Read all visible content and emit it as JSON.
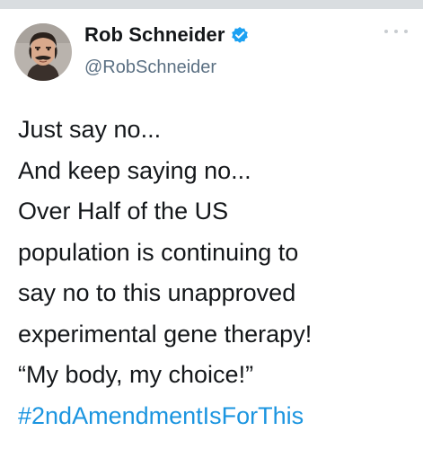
{
  "tweet": {
    "author": {
      "display_name": "Rob Schneider",
      "handle": "@RobSchneider",
      "verified": true,
      "avatar_icon": "avatar-photo",
      "verified_icon": "verified-badge-icon"
    },
    "lines": [
      "Just say no...",
      "And keep saying no...",
      "Over Half of the US",
      "population is continuing to",
      "say no to this unapproved",
      "experimental gene therapy!",
      "“My body, my choice!”"
    ],
    "hashtag": "#2ndAmendmentIsForThis"
  },
  "colors": {
    "text": "#14171a",
    "handle": "#5b7083",
    "link": "#1b95e0",
    "verified": "#1da1f2",
    "top_strip": "#d9dde0"
  }
}
